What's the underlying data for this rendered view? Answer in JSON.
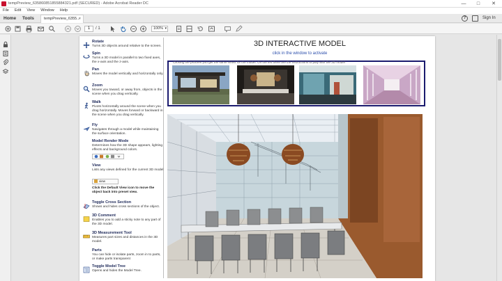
{
  "window": {
    "title": "tempPreview_635860851855884321.pdf (SECURED) - Adobe Acrobat Reader DC",
    "minimize": "—",
    "maximize": "□",
    "close": "✕"
  },
  "menu": [
    "File",
    "Edit",
    "View",
    "Window",
    "Help"
  ],
  "tabs": {
    "home": "Home",
    "tools": "Tools",
    "document": "tempPreview_6355...",
    "document_close": "×",
    "help": "?",
    "sign_in": "Sign In"
  },
  "toolbar": {
    "page_current": "1",
    "page_total": "/ 1",
    "zoom": "100%"
  },
  "document": {
    "heading": "3D INTERACTIVE MODEL",
    "subheading": "click in the window to activate",
    "thumb_caption": "Clicking the pictures you get the same views for the model. On the left there are the instructions to play with the 3D model"
  },
  "help": {
    "rotate": {
      "title": "Rotate",
      "desc": "Turns 3D objects around relative to the screen."
    },
    "spin": {
      "title": "Spin",
      "desc": "Turns a 3D model in parallel to two fixed axes, the x-axis and the z-axis."
    },
    "pan": {
      "title": "Pan",
      "desc": "Moves the model vertically and horizontally only."
    },
    "zoom": {
      "title": "Zoom",
      "desc": "Moves you toward, or away from, objects in the scene when you drag vertically."
    },
    "walk": {
      "title": "Walk",
      "desc": "Pivots horizontally around the scene when you drag horizontally. Moves forward or backward in the scene when you drag vertically."
    },
    "fly": {
      "title": "Fly",
      "desc": "Navigates through a model while maintaining the surface orientation."
    },
    "render": {
      "title": "Model Render Mode",
      "desc": "Determines how the 3D shape appears, lighting effects and background colors."
    },
    "view": {
      "title": "View",
      "desc": "Lists any views defined for the current 3D model",
      "select": "view"
    },
    "default_view": "Click the Default View icon to move the object back into  preset view.",
    "cross": {
      "title": "Toggle Cross Section",
      "desc": "Shows and hides cross sections of the object."
    },
    "comment": {
      "title": "3D Comment",
      "desc": "Enables you to add a sticky note to any part of the 3D model."
    },
    "measure": {
      "title": "3D Measurement Tool",
      "desc": "Measures part sizes and distances in the 3D model."
    },
    "parts": {
      "title": "Parts",
      "desc": "You can hide or isolate parts, zoom in to parts, or make parts transparent"
    },
    "tree": {
      "title": "Toggle Model Tree",
      "desc": "Opens and hides the Model Tree."
    }
  },
  "colors": {
    "accent_blue": "#2b4eab",
    "frame_navy": "#1a1a6e",
    "help_title": "#1f2a5a",
    "acrobat_red": "#c8102e"
  }
}
